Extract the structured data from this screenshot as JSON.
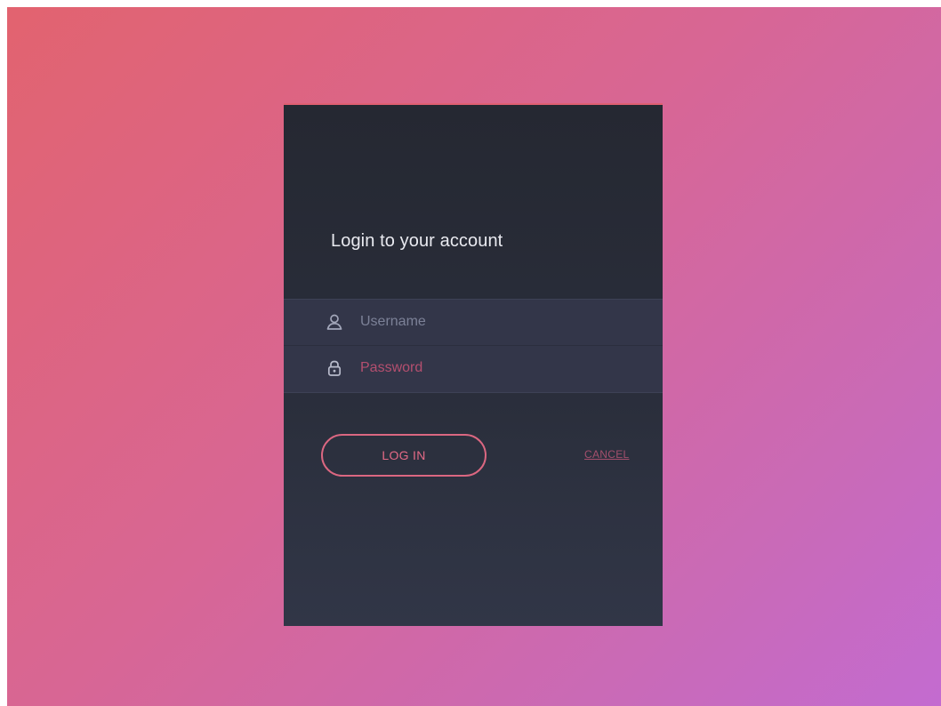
{
  "login": {
    "title": "Login to your account",
    "username": {
      "placeholder": "Username",
      "value": "",
      "icon": "user-icon"
    },
    "password": {
      "placeholder": "Password",
      "value": "",
      "icon": "lock-icon"
    },
    "login_label": "LOG IN",
    "cancel_label": "CANCEL"
  },
  "colors": {
    "background_gradient": [
      "#e2636f",
      "#c36bd0"
    ],
    "card": "#2a2e3b",
    "field_bg": "#333649",
    "accent": "#e05f72"
  }
}
